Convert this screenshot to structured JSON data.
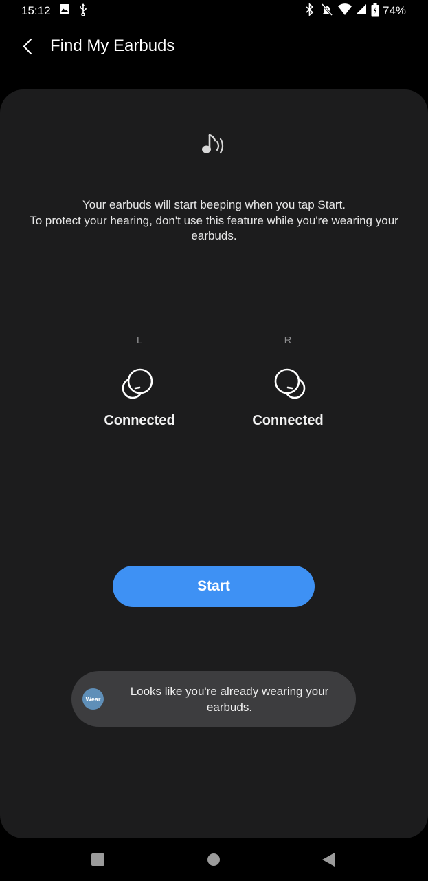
{
  "status_bar": {
    "time": "15:12",
    "battery": "74%",
    "icons": [
      "image-icon",
      "usb-icon",
      "bluetooth-icon",
      "silent-icon",
      "wifi-icon",
      "signal-icon",
      "battery-icon"
    ]
  },
  "app_bar": {
    "title": "Find My Earbuds",
    "back_icon": "chevron-left-icon"
  },
  "card": {
    "icon": "music-sound-icon",
    "description_line1": "Your earbuds will start beeping when you tap Start.",
    "description_line2": "To protect your hearing, don't use this feature while you're wearing your earbuds."
  },
  "earbuds": {
    "left": {
      "side": "L",
      "status": "Connected"
    },
    "right": {
      "side": "R",
      "status": "Connected"
    }
  },
  "start_button": {
    "label": "Start",
    "color": "#3e91f4"
  },
  "toast": {
    "logo_text": "Wear",
    "message": "Looks like you're already wearing your earbuds."
  },
  "nav_bar": {
    "icons": [
      "recents-icon",
      "home-icon",
      "back-icon"
    ]
  },
  "colors": {
    "background": "#000000",
    "card": "#1c1c1d",
    "accent": "#3e91f4",
    "toast": "#3d3d3f"
  }
}
